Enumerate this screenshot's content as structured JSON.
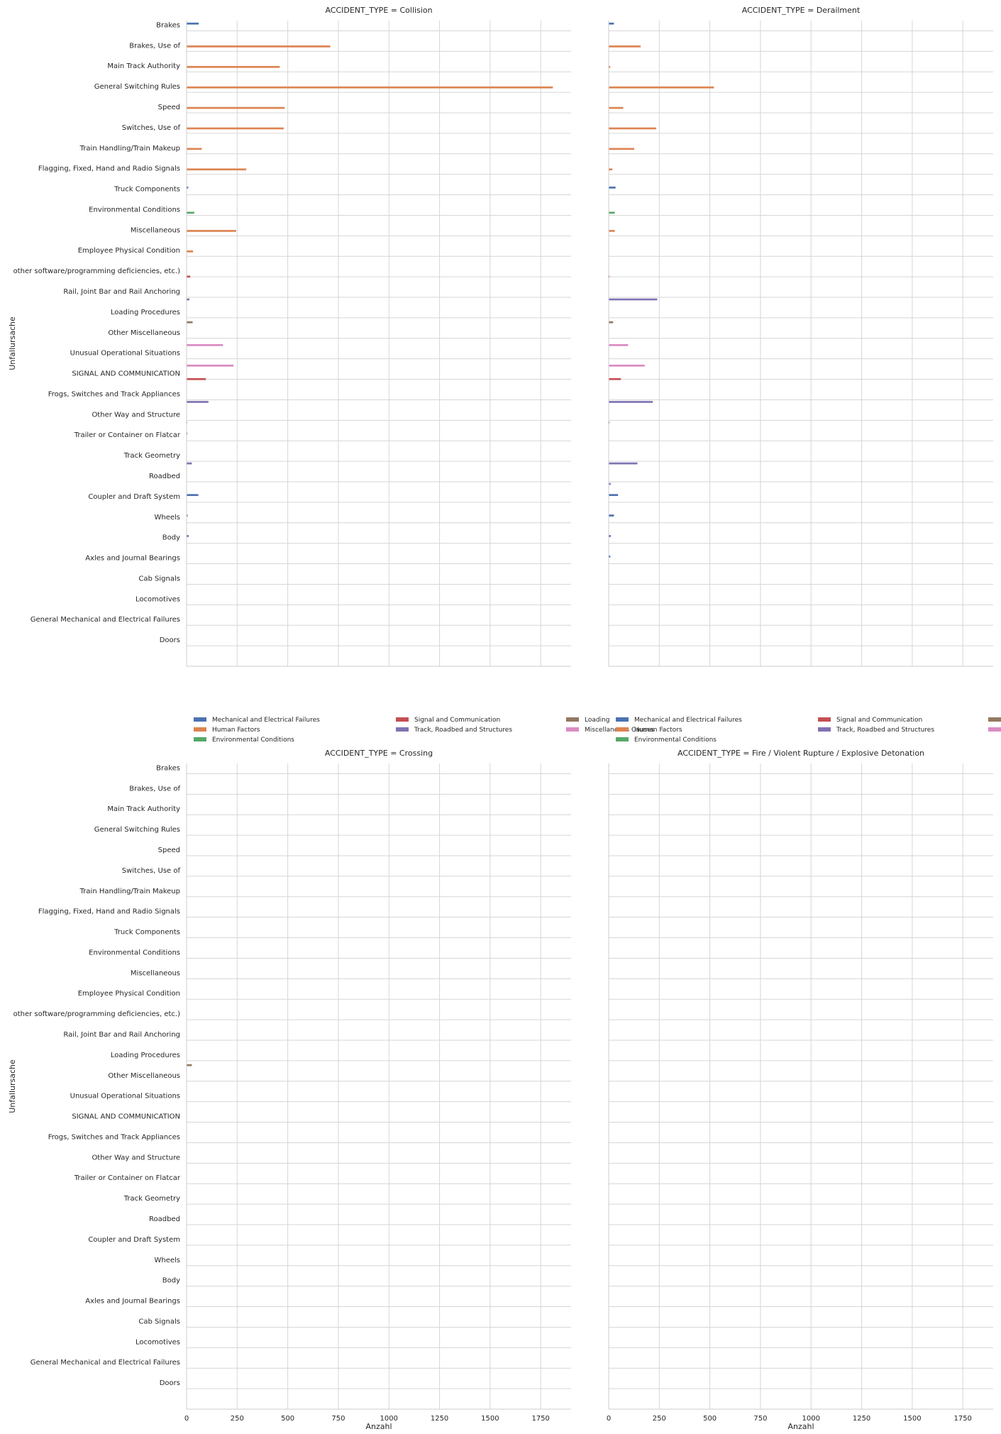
{
  "chart_data": {
    "type": "bar",
    "orientation": "horizontal",
    "xlabel": "Anzahl",
    "ylabel": "Unfallursache",
    "xlim": [
      0,
      1900
    ],
    "xticks": [
      0,
      250,
      500,
      750,
      1000,
      1250,
      1500,
      1750
    ],
    "grid": true,
    "categories": [
      "Brakes",
      "Brakes, Use of",
      "Main Track Authority",
      "General Switching Rules",
      "Speed",
      "Switches, Use of",
      "Train Handling/Train Makeup",
      "Flagging, Fixed, Hand and Radio Signals",
      "Truck Components",
      "Environmental Conditions",
      "Miscellaneous",
      "Employee Physical Condition",
      "other software/programming deficiencies, etc.)",
      "Rail, Joint Bar and Rail Anchoring",
      "Loading Procedures",
      "Other Miscellaneous",
      "Unusual Operational Situations",
      "SIGNAL AND COMMUNICATION",
      "Frogs, Switches and Track Appliances",
      "Other Way and Structure",
      "Trailer or Container on Flatcar",
      "Track Geometry",
      "Roadbed",
      "Coupler and Draft System",
      "Wheels",
      "Body",
      "Axles and Journal Bearings",
      "Cab Signals",
      "Locomotives",
      "General Mechanical and Electrical Failures",
      "Doors"
    ],
    "hue_order": [
      "Mechanical and Electrical Failures",
      "Human Factors",
      "Environmental Conditions",
      "Signal and Communication",
      "Track, Roadbed and Structures",
      "Loading",
      "Miscellaneous Causes"
    ],
    "colors": {
      "Mechanical and Electrical Failures": "#4c72b0",
      "Human Factors": "#dd8452",
      "Environmental Conditions": "#55a868",
      "Signal and Communication": "#c44e52",
      "Track, Roadbed and Structures": "#8172b3",
      "Loading": "#937860",
      "Miscellaneous Causes": "#da8bc3"
    },
    "legend_items": [
      "Mechanical and Electrical Failures",
      "Signal and Communication",
      "Loading",
      "Human Factors",
      "Track, Roadbed and Structures",
      "Miscellaneous Causes",
      "Environmental Conditions"
    ],
    "panels": [
      {
        "title": "ACCIDENT_TYPE = Collision",
        "bars": [
          {
            "category": "Brakes",
            "group": "Mechanical and Electrical Failures",
            "value": 60
          },
          {
            "category": "Brakes, Use of",
            "group": "Human Factors",
            "value": 710
          },
          {
            "category": "Main Track Authority",
            "group": "Human Factors",
            "value": 460
          },
          {
            "category": "General Switching Rules",
            "group": "Human Factors",
            "value": 1810
          },
          {
            "category": "Speed",
            "group": "Human Factors",
            "value": 485
          },
          {
            "category": "Switches, Use of",
            "group": "Human Factors",
            "value": 480
          },
          {
            "category": "Train Handling/Train Makeup",
            "group": "Human Factors",
            "value": 75
          },
          {
            "category": "Flagging, Fixed, Hand and Radio Signals",
            "group": "Human Factors",
            "value": 295
          },
          {
            "category": "Truck Components",
            "group": "Mechanical and Electrical Failures",
            "value": 8
          },
          {
            "category": "Environmental Conditions",
            "group": "Environmental Conditions",
            "value": 38
          },
          {
            "category": "Miscellaneous",
            "group": "Human Factors",
            "value": 245
          },
          {
            "category": "Employee Physical Condition",
            "group": "Human Factors",
            "value": 32
          },
          {
            "category": "other software/programming deficiencies, etc.)",
            "group": "Signal and Communication",
            "value": 18
          },
          {
            "category": "Rail, Joint Bar and Rail Anchoring",
            "group": "Track, Roadbed and Structures",
            "value": 14
          },
          {
            "category": "Loading Procedures",
            "group": "Loading",
            "value": 30
          },
          {
            "category": "Other Miscellaneous",
            "group": "Miscellaneous Causes",
            "value": 180
          },
          {
            "category": "Unusual Operational Situations",
            "group": "Miscellaneous Causes",
            "value": 232
          },
          {
            "category": "SIGNAL AND COMMUNICATION",
            "group": "Signal and Communication",
            "value": 95
          },
          {
            "category": "Frogs, Switches and Track Appliances",
            "group": "Track, Roadbed and Structures",
            "value": 108
          },
          {
            "category": "Other Way and Structure",
            "group": "Track, Roadbed and Structures",
            "value": 3
          },
          {
            "category": "Trailer or Container on Flatcar",
            "group": "Mechanical and Electrical Failures",
            "value": 4
          },
          {
            "category": "Track Geometry",
            "group": "Track, Roadbed and Structures",
            "value": 26
          },
          {
            "category": "Coupler and Draft System",
            "group": "Mechanical and Electrical Failures",
            "value": 58
          },
          {
            "category": "Wheels",
            "group": "Mechanical and Electrical Failures",
            "value": 5
          },
          {
            "category": "Body",
            "group": "Mechanical and Electrical Failures",
            "value": 10
          }
        ]
      },
      {
        "title": "ACCIDENT_TYPE = Derailment",
        "bars": [
          {
            "category": "Brakes",
            "group": "Mechanical and Electrical Failures",
            "value": 26
          },
          {
            "category": "Brakes, Use of",
            "group": "Human Factors",
            "value": 158
          },
          {
            "category": "Main Track Authority",
            "group": "Human Factors",
            "value": 8
          },
          {
            "category": "General Switching Rules",
            "group": "Human Factors",
            "value": 520
          },
          {
            "category": "Speed",
            "group": "Human Factors",
            "value": 72
          },
          {
            "category": "Switches, Use of",
            "group": "Human Factors",
            "value": 235
          },
          {
            "category": "Train Handling/Train Makeup",
            "group": "Human Factors",
            "value": 126
          },
          {
            "category": "Flagging, Fixed, Hand and Radio Signals",
            "group": "Human Factors",
            "value": 18
          },
          {
            "category": "Truck Components",
            "group": "Mechanical and Electrical Failures",
            "value": 34
          },
          {
            "category": "Environmental Conditions",
            "group": "Environmental Conditions",
            "value": 30
          },
          {
            "category": "Miscellaneous",
            "group": "Human Factors",
            "value": 30
          },
          {
            "category": "other software/programming deficiencies, etc.)",
            "group": "Signal and Communication",
            "value": 4
          },
          {
            "category": "Rail, Joint Bar and Rail Anchoring",
            "group": "Track, Roadbed and Structures",
            "value": 240
          },
          {
            "category": "Loading Procedures",
            "group": "Loading",
            "value": 22
          },
          {
            "category": "Other Miscellaneous",
            "group": "Miscellaneous Causes",
            "value": 96
          },
          {
            "category": "Unusual Operational Situations",
            "group": "Miscellaneous Causes",
            "value": 178
          },
          {
            "category": "SIGNAL AND COMMUNICATION",
            "group": "Signal and Communication",
            "value": 60
          },
          {
            "category": "Frogs, Switches and Track Appliances",
            "group": "Track, Roadbed and Structures",
            "value": 218
          },
          {
            "category": "Other Way and Structure",
            "group": "Track, Roadbed and Structures",
            "value": 4
          },
          {
            "category": "Track Geometry",
            "group": "Track, Roadbed and Structures",
            "value": 142
          },
          {
            "category": "Roadbed",
            "group": "Track, Roadbed and Structures",
            "value": 10
          },
          {
            "category": "Coupler and Draft System",
            "group": "Mechanical and Electrical Failures",
            "value": 46
          },
          {
            "category": "Wheels",
            "group": "Mechanical and Electrical Failures",
            "value": 26
          },
          {
            "category": "Body",
            "group": "Mechanical and Electrical Failures",
            "value": 10
          },
          {
            "category": "Axles and Journal Bearings",
            "group": "Mechanical and Electrical Failures",
            "value": 8
          }
        ]
      },
      {
        "title": "ACCIDENT_TYPE = Crossing",
        "bars": [
          {
            "category": "Loading Procedures",
            "group": "Loading",
            "value": 26
          }
        ]
      },
      {
        "title": "ACCIDENT_TYPE = Fire / Violent Rupture / Explosive Detonation",
        "bars": []
      }
    ]
  }
}
